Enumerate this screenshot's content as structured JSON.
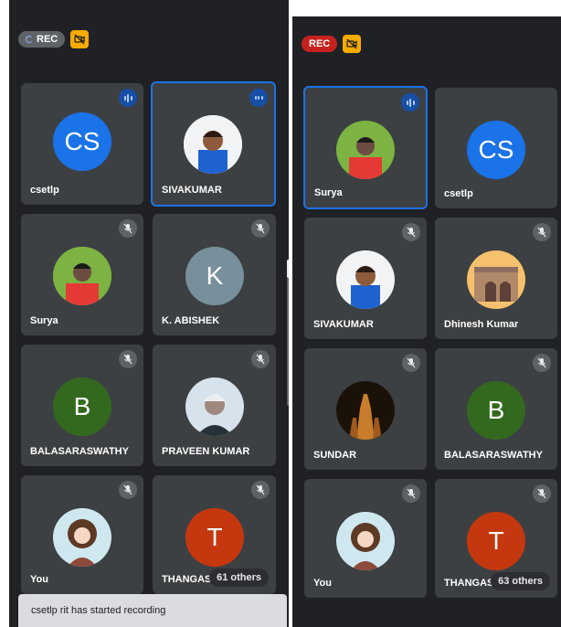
{
  "left": {
    "rec_label": "REC",
    "tiles": [
      {
        "name": "csetlp",
        "initials": "CS",
        "color": "#1a73e8",
        "status": "speaking"
      },
      {
        "name": "SIVAKUMAR",
        "status": "speaking",
        "active": true
      },
      {
        "name": "Surya",
        "status": "muted"
      },
      {
        "name": "K. ABISHEK",
        "initials": "K",
        "color": "#78909c",
        "status": "muted"
      },
      {
        "name": "BALASARASWATHY",
        "initials": "B",
        "color": "#33691e",
        "status": "muted"
      },
      {
        "name": "PRAVEEN KUMAR",
        "status": "muted"
      },
      {
        "name": "You",
        "status": "muted"
      },
      {
        "name": "THANGAS",
        "initials": "T",
        "color": "#c5380f",
        "status": "muted"
      }
    ],
    "others": "61 others",
    "toast": "csetlp rit has started recording"
  },
  "right": {
    "rec_label": "REC",
    "tiles": [
      {
        "name": "Surya",
        "status": "speaking",
        "active": true
      },
      {
        "name": "csetlp",
        "initials": "CS",
        "color": "#1a73e8",
        "status": "none"
      },
      {
        "name": "SIVAKUMAR",
        "status": "muted"
      },
      {
        "name": "Dhinesh Kumar",
        "status": "muted"
      },
      {
        "name": "SUNDAR",
        "status": "muted"
      },
      {
        "name": "BALASARASWATHY",
        "initials": "B",
        "color": "#33691e",
        "status": "muted"
      },
      {
        "name": "You",
        "status": "muted"
      },
      {
        "name": "THANGAS",
        "initials": "T",
        "color": "#c5380f",
        "status": "muted"
      }
    ],
    "others": "63 others"
  },
  "colors": {
    "background": "#202124",
    "tile": "#3c4043",
    "active_border": "#1a73e8",
    "rec_red": "#c5221f",
    "cam_off": "#f9ab00"
  }
}
